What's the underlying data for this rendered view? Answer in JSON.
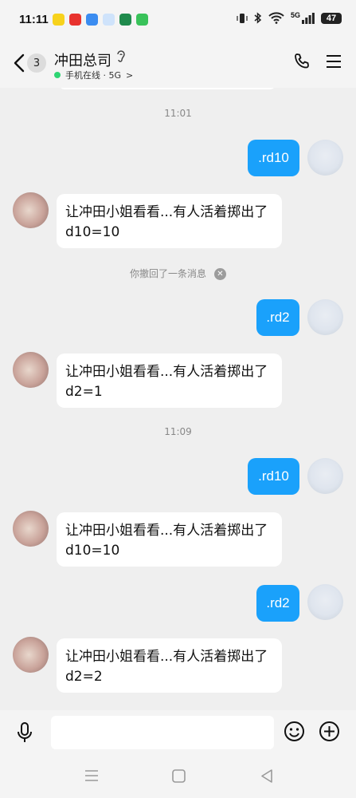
{
  "status": {
    "time": "11:11",
    "battery": "47",
    "network": "5G"
  },
  "header": {
    "unread_count": "3",
    "title": "冲田总司",
    "presence": "手机在线 · 5G"
  },
  "messages": [
    {
      "type": "time",
      "text": "11:01"
    },
    {
      "type": "out",
      "text": ".rd10"
    },
    {
      "type": "in",
      "lines": [
        "让冲田小姐看看...有人活着掷出了",
        "d10=10"
      ]
    },
    {
      "type": "recall",
      "text": "你撤回了一条消息"
    },
    {
      "type": "out",
      "text": ".rd2"
    },
    {
      "type": "in",
      "lines": [
        "让冲田小姐看看...有人活着掷出了",
        "d2=1"
      ]
    },
    {
      "type": "time",
      "text": "11:09"
    },
    {
      "type": "out",
      "text": ".rd10"
    },
    {
      "type": "in",
      "lines": [
        "让冲田小姐看看...有人活着掷出了",
        "d10=10"
      ]
    },
    {
      "type": "out",
      "text": ".rd2"
    },
    {
      "type": "in",
      "lines": [
        "让冲田小姐看看...有人活着掷出了",
        "d2=2"
      ]
    }
  ],
  "input": {
    "placeholder": ""
  },
  "colors": {
    "outgoing_bubble": "#1aa1fb",
    "online_dot": "#2ed573",
    "background": "#efefef"
  },
  "icons": [
    "back-icon",
    "ear-icon",
    "phone-icon",
    "menu-icon",
    "mic-icon",
    "emoji-icon",
    "plus-icon",
    "recall-close-icon"
  ]
}
